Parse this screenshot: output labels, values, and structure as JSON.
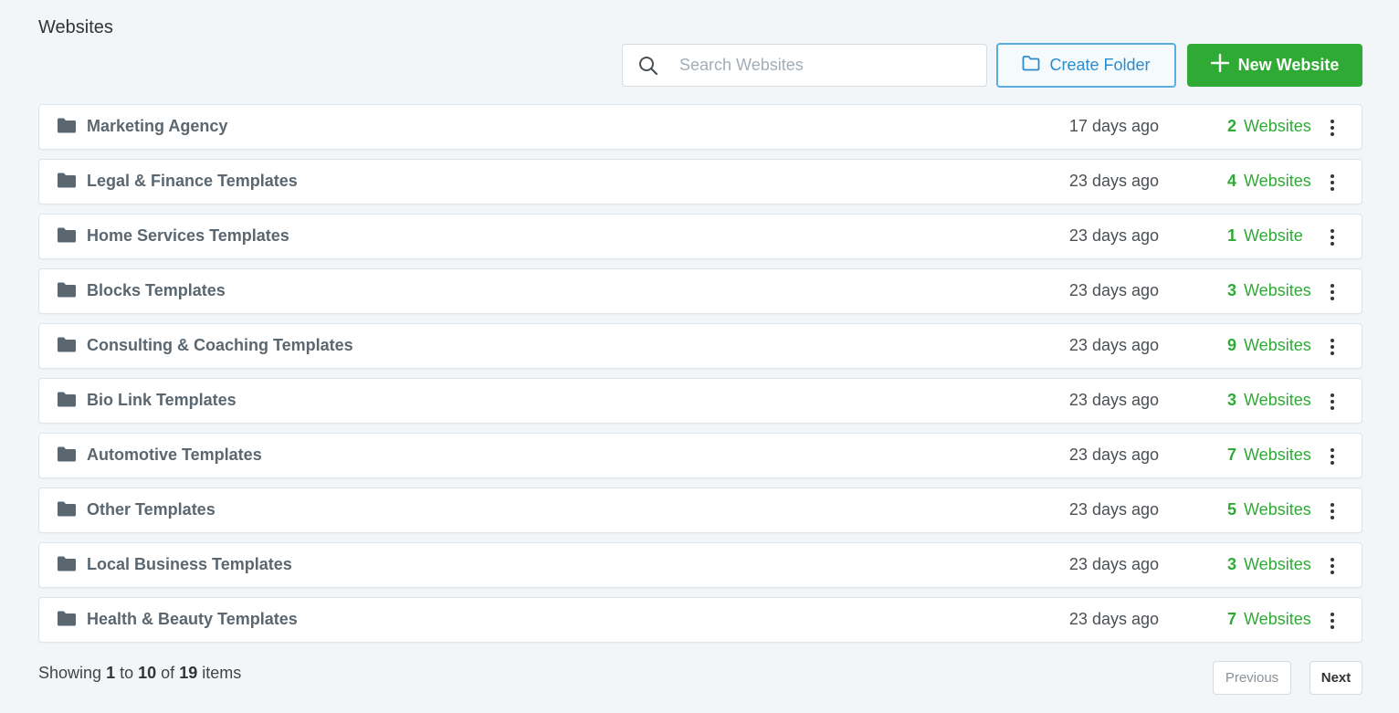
{
  "header": {
    "title": "Websites",
    "search_placeholder": "Search Websites",
    "create_folder_label": "Create Folder",
    "new_website_label": "New Website"
  },
  "folders": [
    {
      "name": "Marketing Agency",
      "updated": "17 days ago",
      "count": "2",
      "unit": "Websites"
    },
    {
      "name": "Legal & Finance Templates",
      "updated": "23 days ago",
      "count": "4",
      "unit": "Websites"
    },
    {
      "name": "Home Services Templates",
      "updated": "23 days ago",
      "count": "1",
      "unit": "Website"
    },
    {
      "name": "Blocks Templates",
      "updated": "23 days ago",
      "count": "3",
      "unit": "Websites"
    },
    {
      "name": "Consulting & Coaching Templates",
      "updated": "23 days ago",
      "count": "9",
      "unit": "Websites"
    },
    {
      "name": "Bio Link Templates",
      "updated": "23 days ago",
      "count": "3",
      "unit": "Websites"
    },
    {
      "name": "Automotive Templates",
      "updated": "23 days ago",
      "count": "7",
      "unit": "Websites"
    },
    {
      "name": "Other Templates",
      "updated": "23 days ago",
      "count": "5",
      "unit": "Websites"
    },
    {
      "name": "Local Business Templates",
      "updated": "23 days ago",
      "count": "3",
      "unit": "Websites"
    },
    {
      "name": "Health & Beauty Templates",
      "updated": "23 days ago",
      "count": "7",
      "unit": "Websites"
    }
  ],
  "pagination": {
    "prefix": "Showing",
    "from": "1",
    "to_word": "to",
    "to": "10",
    "of_word": "of",
    "total": "19",
    "suffix": "items",
    "previous_label": "Previous",
    "next_label": "Next"
  },
  "colors": {
    "accent_green": "#2eaa35",
    "accent_blue": "#2b8ccd",
    "background": "#f2f6f8"
  },
  "icons": {
    "search": "search-icon",
    "folder_outline": "folder-outline-icon",
    "plus": "plus-icon",
    "folder": "folder-icon",
    "kebab": "kebab-menu-icon"
  }
}
